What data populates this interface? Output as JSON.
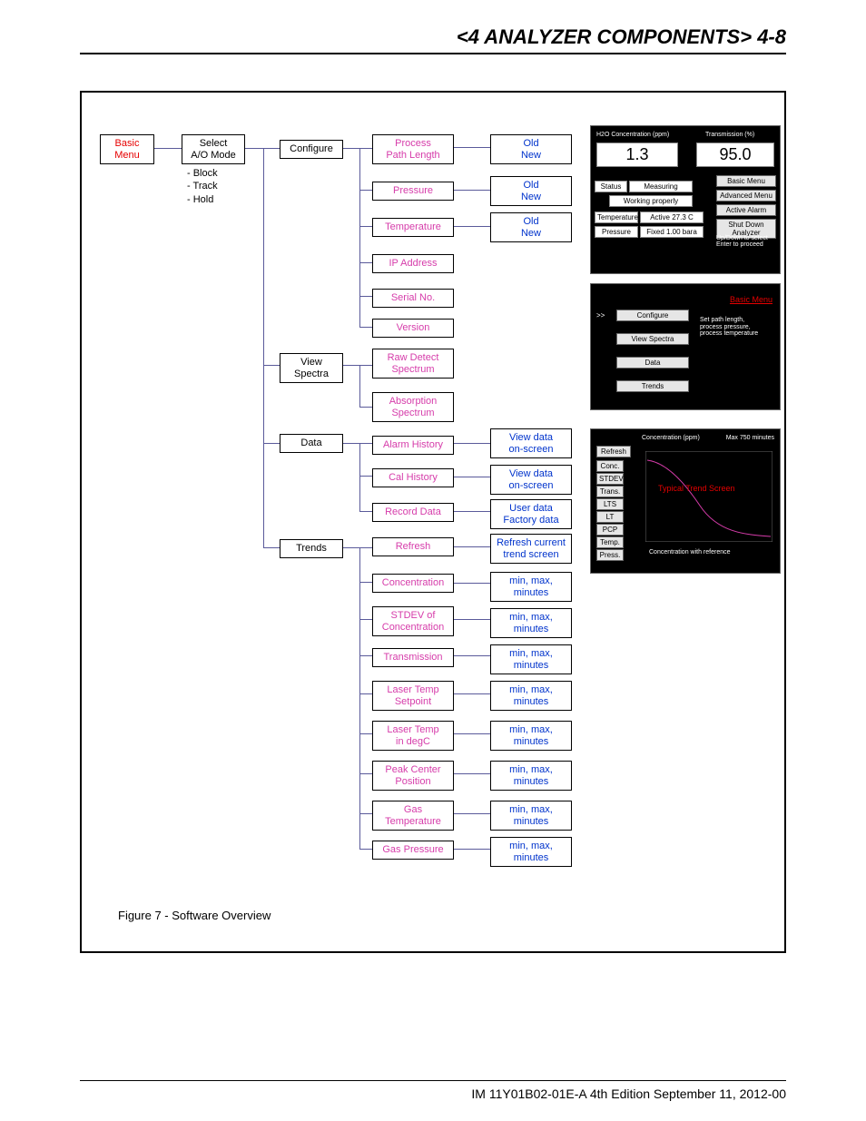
{
  "header": {
    "title": "<4 ANALYZER COMPONENTS>  4-8"
  },
  "footer": {
    "text": "IM 11Y01B02-01E-A  4th Edition September 11, 2012-00"
  },
  "caption": "Figure 7 - Software Overview",
  "tree": {
    "basic_menu": "Basic\nMenu",
    "select_ao": "Select\nA/O Mode",
    "select_ao_items": "- Block\n- Track\n- Hold",
    "configure": "Configure",
    "view_spectra": "View\nSpectra",
    "data": "Data",
    "trends": "Trends",
    "cfg": {
      "process_path": "Process\nPath Length",
      "pressure": "Pressure",
      "temperature": "Temperature",
      "ip": "IP Address",
      "serial": "Serial No.",
      "version": "Version"
    },
    "vs": {
      "raw": "Raw Detect\nSpectrum",
      "abs": "Absorption\nSpectrum"
    },
    "dt": {
      "alarm": "Alarm History",
      "cal": "Cal History",
      "record": "Record Data"
    },
    "tr": {
      "refresh": "Refresh",
      "conc": "Concentration",
      "stdev": "STDEV of\nConcentration",
      "transm": "Transmission",
      "ltsp": "Laser Temp\nSetpoint",
      "ltdeg": "Laser Temp\nin degC",
      "peak": "Peak Center\nPosition",
      "gast": "Gas\nTemperature",
      "gasp": "Gas Pressure"
    },
    "leaf": {
      "old_new": "Old\nNew",
      "view_onscreen": "View data\non-screen",
      "user_factory": "User data\nFactory data",
      "refresh_current": "Refresh current\ntrend screen",
      "min_max": "min, max,\nminutes"
    }
  },
  "panel1": {
    "h2o_label": "H2O Concentration (ppm)",
    "trans_label": "Transmission (%)",
    "h2o_val": "1.3",
    "trans_val": "95.0",
    "status_l": "Status",
    "status_r": "Measuring",
    "working": "Working properly",
    "temp_l": "Temperature",
    "temp_r": "Active 27.3 C",
    "press_l": "Pressure",
    "press_r": "Fixed 1.00 bara",
    "m1": "Basic Menu",
    "m2": "Advanced Menu",
    "m3": "Active Alarm",
    "m4": "Shut Down Analyzer",
    "m5": "Up/Down to select\nEnter to proceed"
  },
  "panel2": {
    "title": "Basic Menu",
    "b1": "Configure",
    "b2": "View Spectra",
    "b3": "Data",
    "b4": "Trends",
    "hint": "Set path length,\nprocess pressure,\nprocess temperature"
  },
  "panel3": {
    "title": "Typical Trend Screen",
    "refresh": "Refresh",
    "conc_lbl": "Concentration (ppm)",
    "max_lbl": "Max 750 minutes",
    "bottom": "Concentration with reference",
    "rows": {
      "conc": "Conc.",
      "stdev": "STDEV",
      "trans": "Trans.",
      "lts": "LTS",
      "lt": "LT",
      "pcp": "PCP",
      "temp": "Temp.",
      "press": "Press."
    }
  }
}
